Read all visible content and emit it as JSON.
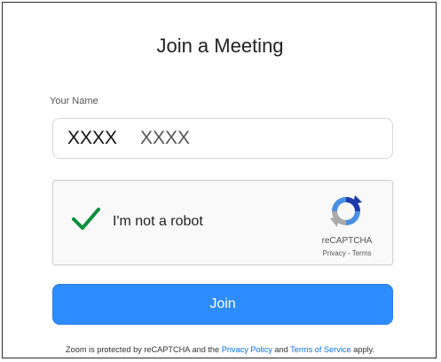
{
  "title": "Join a Meeting",
  "name_field": {
    "label": "Your Name",
    "value_first": "XXXX",
    "value_last": "XXXX"
  },
  "captcha": {
    "label": "I'm not a robot",
    "brand": "reCAPTCHA",
    "links": "Privacy - Terms",
    "checked": true,
    "icon": "check-icon"
  },
  "join_button": {
    "label": "Join"
  },
  "footer": {
    "text_before": "Zoom is protected by reCAPTCHA and the ",
    "privacy_link": "Privacy Policy",
    "text_middle": " and ",
    "terms_link": "Terms of Service",
    "text_after": " apply."
  },
  "colors": {
    "accent": "#2d8cff",
    "link": "#0e71eb",
    "check": "#0a8f3d"
  }
}
